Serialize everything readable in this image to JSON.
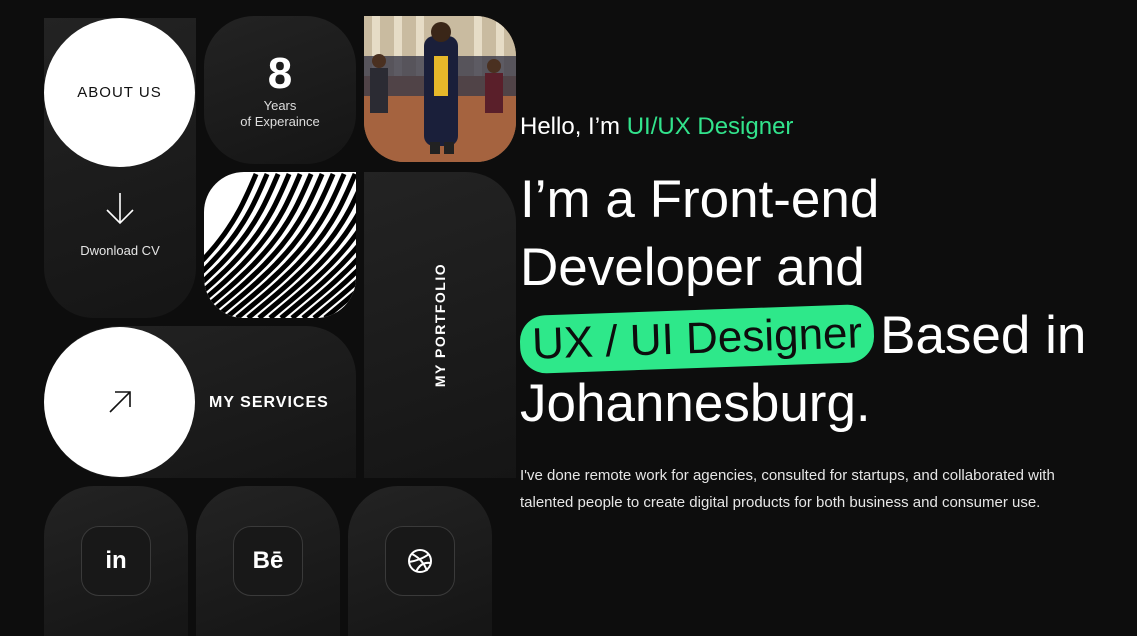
{
  "about": {
    "label": "ABOUT US"
  },
  "cv": {
    "icon": "arrow-down-icon",
    "label": "Dwonload CV"
  },
  "experience": {
    "number": "8",
    "line1": "Years",
    "line2": "of Experaince"
  },
  "portfolio": {
    "label": "MY PORTFOLIO"
  },
  "services": {
    "icon": "arrow-up-right-icon",
    "label": "MY SERVICES"
  },
  "socials": [
    {
      "name": "linkedin",
      "glyph": "in"
    },
    {
      "name": "behance",
      "glyph": "Bē"
    },
    {
      "name": "dribbble",
      "glyph": "dribbble-icon"
    }
  ],
  "hero": {
    "greeting_prefix": "Hello, I’m ",
    "greeting_accent": "UI/UX Designer",
    "line1": "I’m a Front-end",
    "line2": "Developer and",
    "highlight": "UX / UI Designer",
    "line3_rest": "Based in",
    "line4": "Johannesburg.",
    "description": "I've done remote work for agencies, consulted for startups, and collaborated with talented people to create digital products for both business and consumer use."
  },
  "colors": {
    "accent": "#2ee88a",
    "background": "#0d0d0d",
    "tile": "#1c1c1c"
  }
}
